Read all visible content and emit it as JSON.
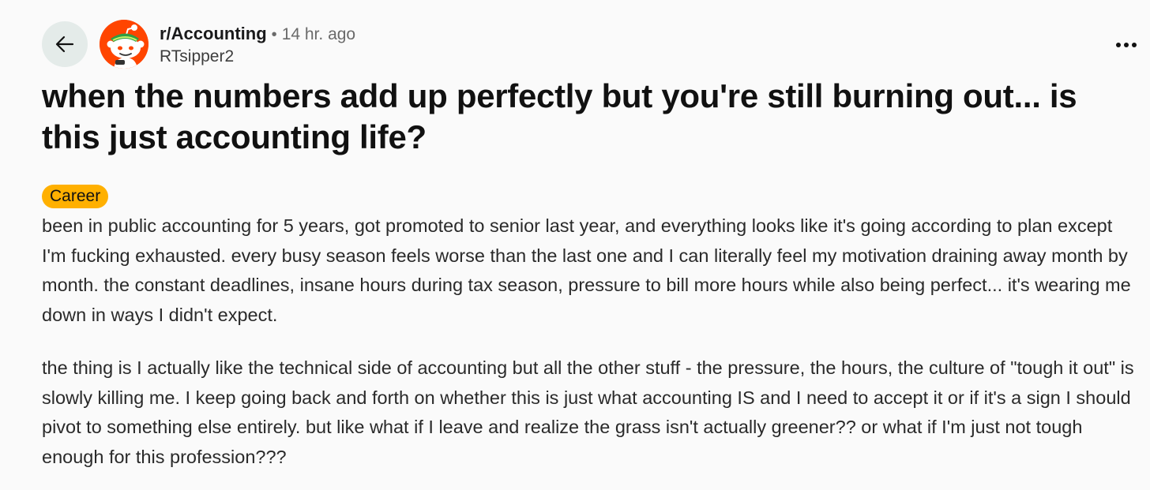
{
  "header": {
    "subreddit": "r/Accounting",
    "separator": "•",
    "time_ago": "14 hr. ago",
    "author": "RTsipper2"
  },
  "icons": {
    "back": "arrow-left-icon",
    "more": "more-horizontal-icon",
    "avatar": "subreddit-avatar"
  },
  "colors": {
    "flair_bg": "#ffb000",
    "avatar_bg": "#ff4500",
    "back_bg": "#e4ebe9"
  },
  "post": {
    "title": "when the numbers add up perfectly but you're still burning out... is this just accounting life?",
    "flair": "Career",
    "paragraphs": [
      "been in public accounting for 5 years, got promoted to senior last year, and everything looks like it's going according to plan except I'm fucking exhausted. every busy season feels worse than the last one and I can literally feel my motivation draining away month by month. the constant deadlines, insane hours during tax season, pressure to bill more hours while also being perfect... it's wearing me down in ways I didn't expect.",
      "the thing is I actually like the technical side of accounting but all the other stuff - the pressure, the hours, the culture of \"tough it out\" is slowly killing me. I keep going back and forth on whether this is just what accounting IS and I need to accept it or if it's a sign I should pivot to something else entirely. but like what if I leave and realize the grass isn't actually greener?? or what if I'm just not tough enough for this profession???"
    ]
  }
}
